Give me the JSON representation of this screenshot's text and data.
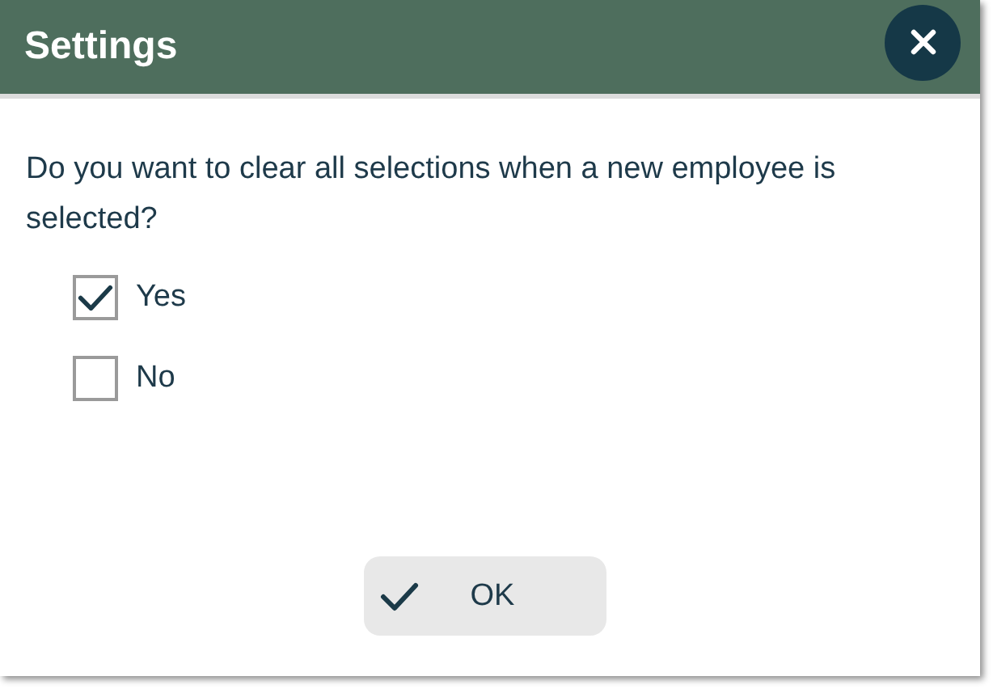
{
  "dialog": {
    "title": "Settings"
  },
  "question": "Do you want to clear all selections when a new employee is selected?",
  "options": [
    {
      "label": "Yes",
      "checked": true
    },
    {
      "label": "No",
      "checked": false
    }
  ],
  "buttons": [
    {
      "label": "OK"
    }
  ]
}
